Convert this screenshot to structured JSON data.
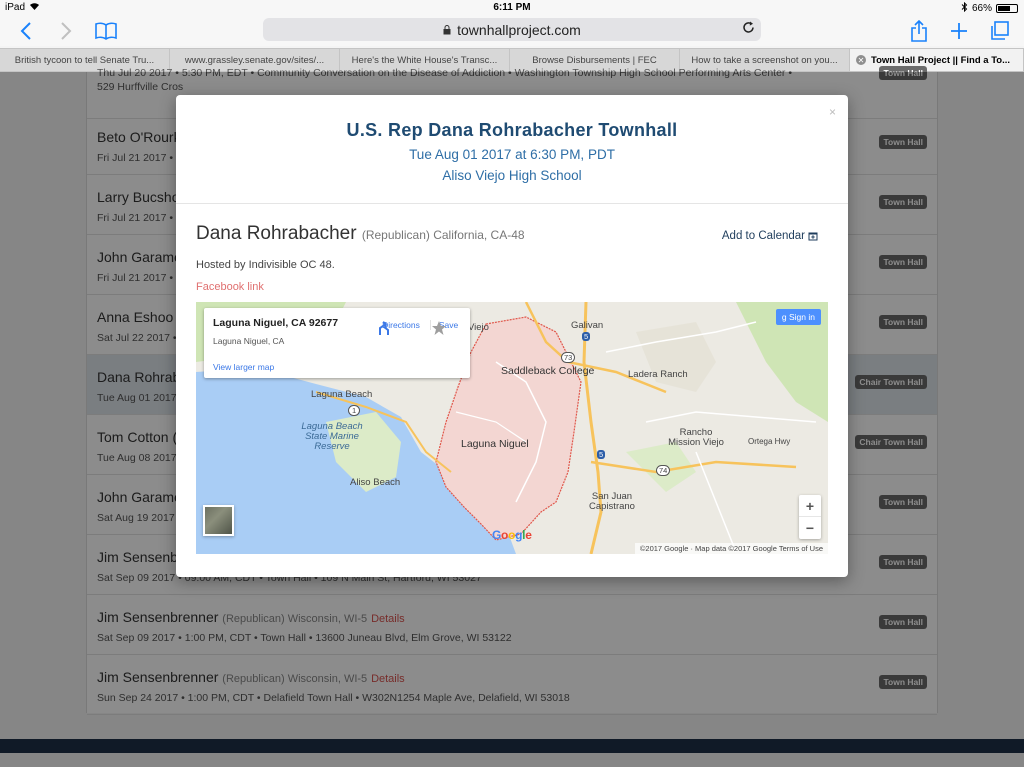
{
  "status_bar": {
    "device": "iPad",
    "time": "6:11 PM",
    "battery_text": "66%",
    "battery_level": 0.66
  },
  "toolbar": {
    "url": "townhallproject.com"
  },
  "tabs": [
    {
      "label": "British tycoon to tell Senate Tru..."
    },
    {
      "label": "www.grassley.senate.gov/sites/..."
    },
    {
      "label": "Here's the White House's Transc..."
    },
    {
      "label": "Browse Disbursements | FEC"
    },
    {
      "label": "How to take a screenshot on you..."
    },
    {
      "label": "Town Hall Project || Find a To..."
    }
  ],
  "rows": [
    {
      "name": "",
      "party": "",
      "details": "",
      "meta": "Thu Jul 20 2017  •  5:30 PM, EDT  •  Community Conversation on the Disease of Addiction  •  Washington Township High School Performing Arts Center  •",
      "meta2": "529 Hurffville Cros",
      "badge": "Town Hall"
    },
    {
      "name": "Beto O'Rourk",
      "party": "",
      "details": "",
      "meta": "Fri Jul 21 2017  •",
      "badge": "Town Hall"
    },
    {
      "name": "Larry Bucsho",
      "party": "",
      "details": "",
      "meta": "Fri Jul 21 2017  •",
      "badge": "Town Hall"
    },
    {
      "name": "John Garame",
      "party": "",
      "details": "",
      "meta": "Fri Jul 21 2017  •",
      "badge": "Town Hall"
    },
    {
      "name": "Anna Eshoo",
      "party": "",
      "details": "",
      "meta": "Sat Jul 22 2017  •",
      "badge": "Town Hall"
    },
    {
      "name": "Dana Rohrab",
      "party": "",
      "details": "",
      "meta": "Tue Aug 01 2017",
      "badge": "Chair Town Hall"
    },
    {
      "name": "Tom Cotton (",
      "party": "",
      "details": "",
      "meta": "Tue Aug 08 2017",
      "badge": "Chair Town Hall"
    },
    {
      "name": "John Garame",
      "party": "",
      "details": "",
      "meta": "Sat Aug 19 2017",
      "badge": "Town Hall"
    },
    {
      "name": "Jim Sensenb",
      "party": "",
      "details": "",
      "meta": "Sat Sep 09 2017  •  09:00 AM, CDT  •  Town Hall  •  109 N Main St, Hartford, WI 53027",
      "badge": "Town Hall"
    },
    {
      "name": "Jim Sensenbrenner",
      "party": "(Republican) Wisconsin, WI-5",
      "details": "Details",
      "meta": "Sat Sep 09 2017  •  1:00 PM, CDT  •  Town Hall  •  13600 Juneau Blvd, Elm Grove, WI 53122",
      "badge": "Town Hall"
    },
    {
      "name": "Jim Sensenbrenner",
      "party": "(Republican) Wisconsin, WI-5",
      "details": "Details",
      "meta": "Sun Sep 24 2017  •  1:00 PM, CDT  •  Delafield Town Hall  •  W302N1254 Maple Ave, Delafield, WI 53018",
      "badge": "Town Hall"
    }
  ],
  "modal": {
    "close": "×",
    "title": "U.S. Rep Dana Rohrabacher Townhall",
    "datetime": "Tue Aug 01 2017 at 6:30 PM, PDT",
    "location": "Aliso Viejo High School",
    "member_name": "Dana Rohrabacher",
    "member_party": "(Republican) California, CA-48",
    "add_to_calendar": "Add to Calendar",
    "hosted_by": "Hosted by Indivisible OC 48.",
    "facebook_link": "Facebook link"
  },
  "map": {
    "card_address": "Laguna Niguel, CA 92677",
    "card_city": "Laguna Niguel, CA",
    "view_larger": "View larger map",
    "directions": "Directions",
    "save": "Save",
    "sign_in": "Sign in",
    "zoom_in": "+",
    "zoom_out": "−",
    "google": "Google",
    "copyright": "©2017 Google · Map data ©2017 Google    Terms of Use",
    "labels": {
      "viejo": "Viejo",
      "galivan": "Galivan",
      "saddleback": "Saddleback College",
      "ladera": "Ladera Ranch",
      "laguna_beach": "Laguna Beach",
      "lbsmr": "Laguna Beach State Marine Reserve",
      "laguna_niguel": "Laguna Niguel",
      "rancho": "Rancho Mission Viejo",
      "aliso_beach": "Aliso Beach",
      "sjc": "San Juan Capistrano",
      "ortega": "Ortega Hwy",
      "r73": "73",
      "r74": "74",
      "r1": "1",
      "r5a": "5",
      "r5b": "5"
    },
    "colors": {
      "water": "#a9cdf5",
      "land": "#eceae3",
      "district": "#f3d6d2",
      "boundary": "#e0564a",
      "highway": "#f7c35c",
      "park": "#cfe5b5"
    }
  }
}
